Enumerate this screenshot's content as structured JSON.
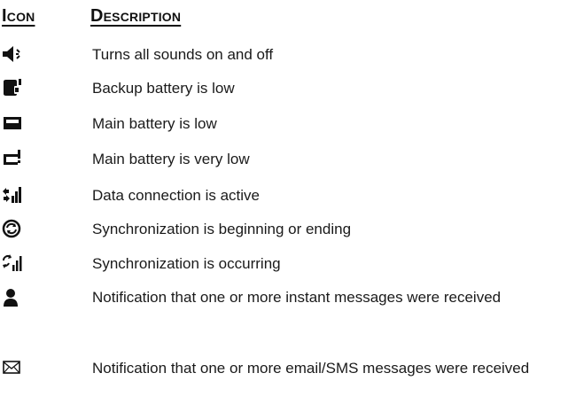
{
  "table": {
    "header": {
      "icon_label": "Icon",
      "description_label": "Description"
    },
    "rows": [
      {
        "icon": "sound-speaker-icon",
        "description": "Turns all sounds on and off"
      },
      {
        "icon": "backup-battery-low-icon",
        "description": "Backup battery is low"
      },
      {
        "icon": "main-battery-low-icon",
        "description": "Main battery is low"
      },
      {
        "icon": "main-battery-very-low-icon",
        "description": "Main battery is very low"
      },
      {
        "icon": "data-connection-active-icon",
        "description": "Data connection is active"
      },
      {
        "icon": "sync-begin-end-icon",
        "description": "Synchronization is beginning or ending"
      },
      {
        "icon": "sync-occurring-icon",
        "description": "Synchronization is occurring"
      },
      {
        "icon": "instant-message-icon",
        "description": "Notification that one or more instant messages were received"
      },
      {
        "icon": "email-sms-icon",
        "description": "Notification that one or more email/SMS messages were received"
      }
    ]
  }
}
